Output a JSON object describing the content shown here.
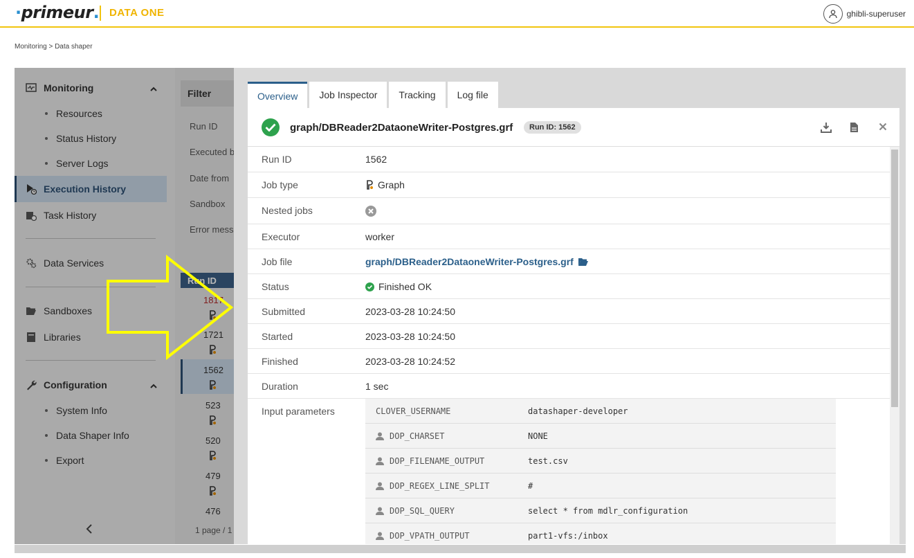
{
  "header": {
    "logo_text": "primeur",
    "product": "DATA ONE",
    "user_name": "ghibli-superuser"
  },
  "breadcrumb": "Monitoring >  Data shaper",
  "sidebar": {
    "monitoring": "Monitoring",
    "monitoring_items": [
      "Resources",
      "Status History",
      "Server Logs"
    ],
    "execution_history": "Execution History",
    "task_history": "Task History",
    "data_services": "Data Services",
    "sandboxes": "Sandboxes",
    "libraries": "Libraries",
    "configuration": "Configuration",
    "configuration_items": [
      "System Info",
      "Data Shaper Info",
      "Export"
    ]
  },
  "filter": {
    "title": "Filter",
    "labels": [
      "Run ID",
      "Executed b",
      "Date from",
      "Sandbox",
      "Error mess"
    ]
  },
  "runs": {
    "header": "Run ID",
    "ids": [
      "1817",
      "1721",
      "1562",
      "523",
      "520",
      "479",
      "476"
    ],
    "pager": "1 page / 1"
  },
  "tabs": [
    "Overview",
    "Job Inspector",
    "Tracking",
    "Log file"
  ],
  "detail": {
    "title": "graph/DBReader2DataoneWriter-Postgres.grf",
    "run_badge": "Run ID: 1562",
    "rows": {
      "run_id": {
        "k": "Run ID",
        "v": "1562"
      },
      "job_type": {
        "k": "Job type",
        "v": "Graph"
      },
      "nested_jobs": {
        "k": "Nested jobs"
      },
      "executor": {
        "k": "Executor",
        "v": "worker"
      },
      "job_file": {
        "k": "Job file",
        "v": "graph/DBReader2DataoneWriter-Postgres.grf"
      },
      "status": {
        "k": "Status",
        "v": "Finished OK"
      },
      "submitted": {
        "k": "Submitted",
        "v": "2023-03-28 10:24:50"
      },
      "started": {
        "k": "Started",
        "v": "2023-03-28 10:24:50"
      },
      "finished": {
        "k": "Finished",
        "v": "2023-03-28 10:24:52"
      },
      "duration": {
        "k": "Duration",
        "v": "1 sec"
      },
      "input_params": {
        "k": "Input parameters"
      }
    },
    "params": [
      {
        "k": "CLOVER_USERNAME",
        "v": "datashaper-developer"
      },
      {
        "k": "DOP_CHARSET",
        "v": "NONE"
      },
      {
        "k": "DOP_FILENAME_OUTPUT",
        "v": "test.csv"
      },
      {
        "k": "DOP_REGEX_LINE_SPLIT",
        "v": "#"
      },
      {
        "k": "DOP_SQL_QUERY",
        "v": "select * from mdlr_configuration"
      },
      {
        "k": "DOP_VPATH_OUTPUT",
        "v": "part1-vfs:/inbox"
      }
    ]
  },
  "colors": {
    "accent": "#2b5f8a",
    "brand": "#f0b400",
    "success": "#2ea24d",
    "annotation": "#ffff00"
  }
}
